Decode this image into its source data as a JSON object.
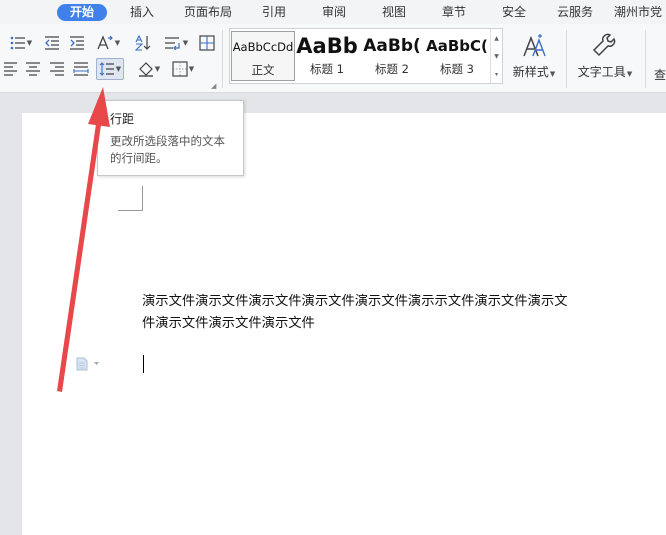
{
  "menu": {
    "tabs": [
      {
        "label": "开始",
        "active": true
      },
      {
        "label": "插入"
      },
      {
        "label": "页面布局"
      },
      {
        "label": "引用"
      },
      {
        "label": "审阅"
      },
      {
        "label": "视图"
      },
      {
        "label": "章节"
      },
      {
        "label": "安全"
      },
      {
        "label": "云服务"
      },
      {
        "label": "潮州市党"
      }
    ]
  },
  "styles": {
    "items": [
      {
        "preview": "AaBbCcDd",
        "name": "正文"
      },
      {
        "preview": "AaBb",
        "name": "标题 1"
      },
      {
        "preview": "AaBb(",
        "name": "标题 2"
      },
      {
        "preview": "AaBbC(",
        "name": "标题 3"
      }
    ]
  },
  "toolbar": {
    "new_style_label": "新样式",
    "text_tools_label": "文字工具",
    "cut_off_label": "查"
  },
  "tooltip": {
    "title": "行距",
    "description": "更改所选段落中的文本的行间距。"
  },
  "document": {
    "text": "演示文件演示文件演示文件演示文件演示文件演示示文件演示文件演示文件演示文件演示文件演示文件"
  },
  "colors": {
    "accent": "#3f80ea",
    "arrow": "#e8484a"
  }
}
